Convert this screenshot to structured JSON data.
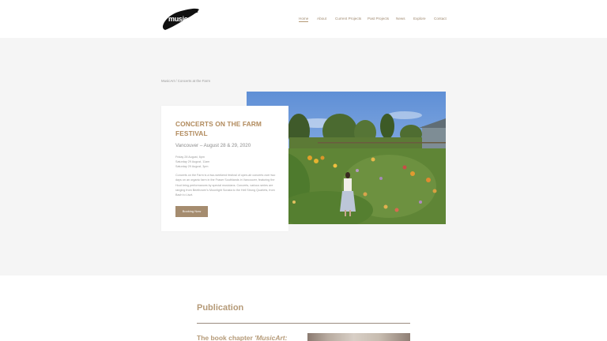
{
  "header": {
    "logo_text": "musicart",
    "nav": [
      {
        "label": "Home",
        "active": true
      },
      {
        "label": "About",
        "active": false
      },
      {
        "label": "Current Projects",
        "active": false
      },
      {
        "label": "Past Projects",
        "active": false
      },
      {
        "label": "News",
        "active": false
      },
      {
        "label": "Explore",
        "active": false
      },
      {
        "label": "Contact",
        "active": false
      }
    ]
  },
  "breadcrumb": "MusicArt / Concerts at the Farm",
  "event": {
    "title": "CONCERTS ON THE FARM FESTIVAL",
    "subtitle": "Vancouver – August 28 & 29, 2020",
    "dates": [
      "Friday 28 August, 6pm",
      "Saturday 29 August, 11am",
      "Saturday 29 August, 3pm"
    ],
    "description": "Concerts on the Farm is a two-weekend festival of open-air concerts over two days on an organic farm in the Fraser Southlands in Vancouver, featuring the Hout bring performances by special musicians. Concerts, various series are ranging from Beethoven's Moonlight Sonata to the Hell Strong Quartets, from Bach to Liszt.",
    "button_label": "Booking Now"
  },
  "publication": {
    "heading": "Publication",
    "subheading_prefix": "The book chapter ",
    "subheading_italic": "'MusicArt:"
  },
  "colors": {
    "accent": "#b18a5c",
    "button": "#a58c6f",
    "band": "#f5f5f5"
  }
}
